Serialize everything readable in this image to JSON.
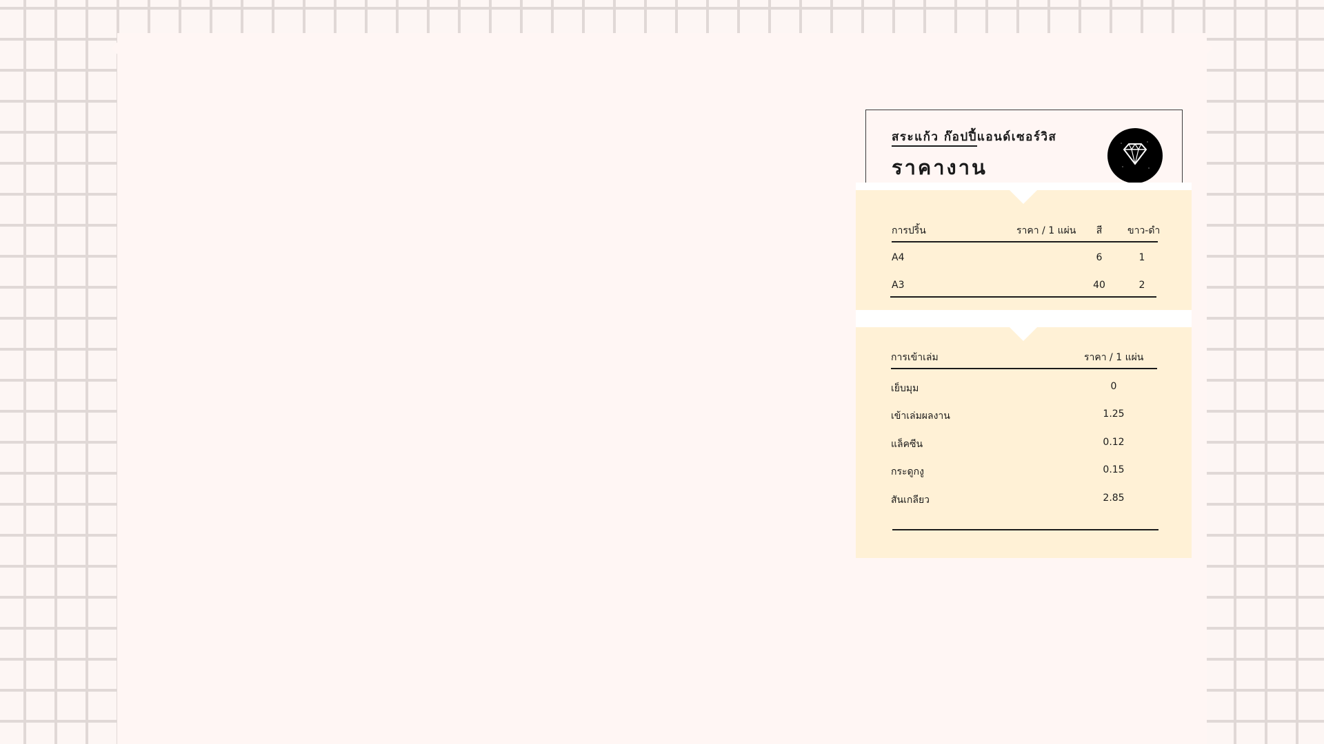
{
  "header": {
    "shop_name": "สระแก้ว ก๊อปปี้แอนด์เซอร์วิส",
    "title": "ราคางาน",
    "logo_icon": "diamond-icon"
  },
  "printing": {
    "headers": [
      "การปริ้น",
      "ราคา / 1 แผ่น",
      "สี",
      "ขาว-ดำ"
    ],
    "rows": [
      {
        "item": "A4",
        "color": "6",
        "bw": "1"
      },
      {
        "item": "A3",
        "color": "40",
        "bw": "2"
      }
    ]
  },
  "binding": {
    "headers": [
      "การเข้าเล่ม",
      "ราคา / 1 แผ่น"
    ],
    "rows": [
      {
        "item": "เย็บมุม",
        "price": "0"
      },
      {
        "item": "เข้าเล่มผลงาน",
        "price": "1.25"
      },
      {
        "item": "แล็คซีน",
        "price": "0.12"
      },
      {
        "item": "กระดูกงู",
        "price": "0.15"
      },
      {
        "item": "สันเกลียว",
        "price": "2.85"
      }
    ]
  },
  "colors": {
    "background": "#fdf6f4",
    "grid": "#e0d8d6",
    "panel": "#fff1d6",
    "ink": "#1a1a1a"
  }
}
